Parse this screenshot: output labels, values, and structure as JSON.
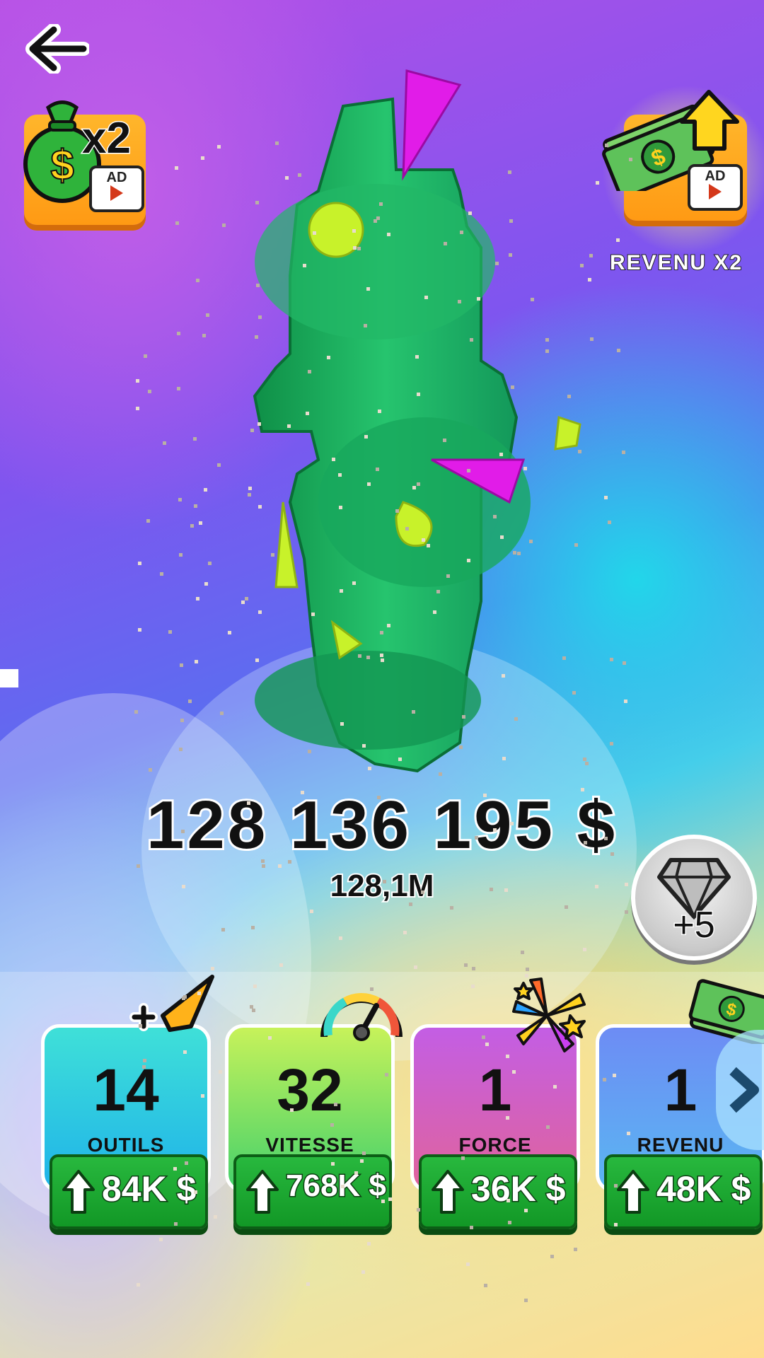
{
  "hud": {
    "money_total": "128 136 195 $",
    "money_short": "128,1M",
    "income_boost_label": "REVENU X2",
    "money_bag_multiplier": "x2",
    "ad_label": "AD",
    "gems_reward": "+5"
  },
  "upgrades": [
    {
      "level": "14",
      "name": "OUTILS",
      "price": "84K $",
      "color_top": "#3fe0d8",
      "color_bottom": "#1fb3e9",
      "icon": "tool-icon"
    },
    {
      "level": "32",
      "name": "VITESSE",
      "price": "768K $",
      "color_top": "#c7f25a",
      "color_bottom": "#44d16b",
      "icon": "speedometer-icon"
    },
    {
      "level": "1",
      "name": "FORCE",
      "price": "36K $",
      "color_top": "#c35ee4",
      "color_bottom": "#e0639c",
      "icon": "explosion-icon"
    },
    {
      "level": "1",
      "name": "REVENU",
      "price": "48K $",
      "color_top": "#6d8cf4",
      "color_bottom": "#5ab6f2",
      "icon": "cash-icon"
    }
  ],
  "colors": {
    "tower_green": "#1fae5c",
    "spike_magenta": "#e11ce8",
    "spike_lime": "#c8f22a",
    "buy_button": "#1fa833"
  }
}
